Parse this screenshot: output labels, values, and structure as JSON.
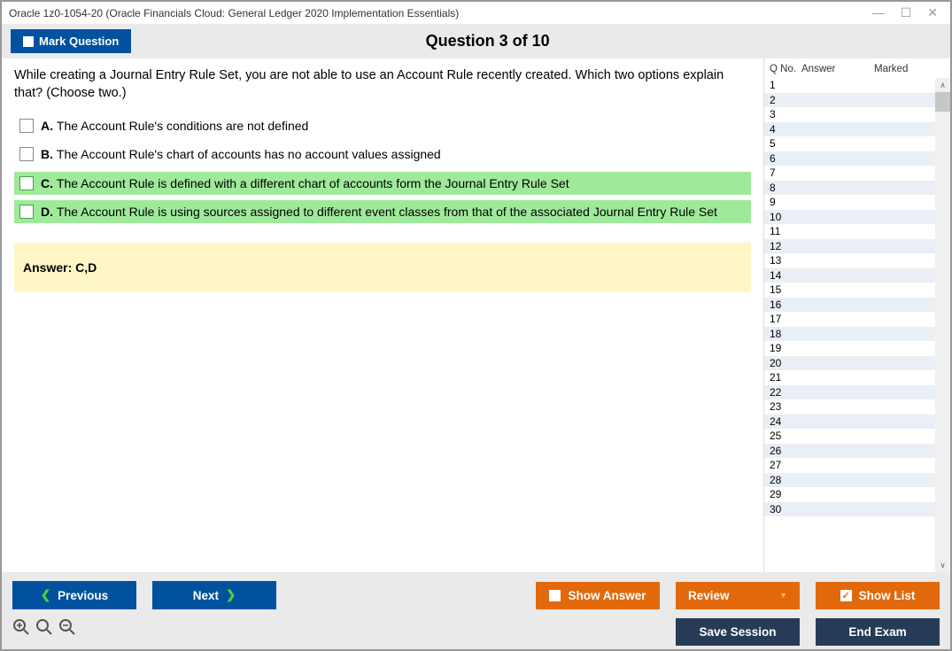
{
  "window": {
    "title": "Oracle 1z0-1054-20 (Oracle Financials Cloud: General Ledger 2020 Implementation Essentials)"
  },
  "header": {
    "mark_label": "Mark Question",
    "question_heading": "Question 3 of 10"
  },
  "question": {
    "text": "While creating a Journal Entry Rule Set, you are not able to use an Account Rule recently created. Which two options explain that? (Choose two.)",
    "options": [
      {
        "letter": "A.",
        "text": "The Account Rule's conditions are not defined",
        "highlight": false
      },
      {
        "letter": "B.",
        "text": "The Account Rule's chart of accounts has no account values assigned",
        "highlight": false
      },
      {
        "letter": "C.",
        "text": "The Account Rule is defined with a different chart of accounts form the Journal Entry Rule Set",
        "highlight": true
      },
      {
        "letter": "D.",
        "text": "The Account Rule is using sources assigned to different event classes from that of the associated Journal Entry Rule Set",
        "highlight": true
      }
    ],
    "answer_label": "Answer: C,D"
  },
  "side": {
    "col_qno": "Q No.",
    "col_answer": "Answer",
    "col_marked": "Marked",
    "rows": [
      "1",
      "2",
      "3",
      "4",
      "5",
      "6",
      "7",
      "8",
      "9",
      "10",
      "11",
      "12",
      "13",
      "14",
      "15",
      "16",
      "17",
      "18",
      "19",
      "20",
      "21",
      "22",
      "23",
      "24",
      "25",
      "26",
      "27",
      "28",
      "29",
      "30"
    ]
  },
  "buttons": {
    "previous": "Previous",
    "next": "Next",
    "show_answer": "Show Answer",
    "review": "Review",
    "show_list": "Show List",
    "save_session": "Save Session",
    "end_exam": "End Exam"
  }
}
